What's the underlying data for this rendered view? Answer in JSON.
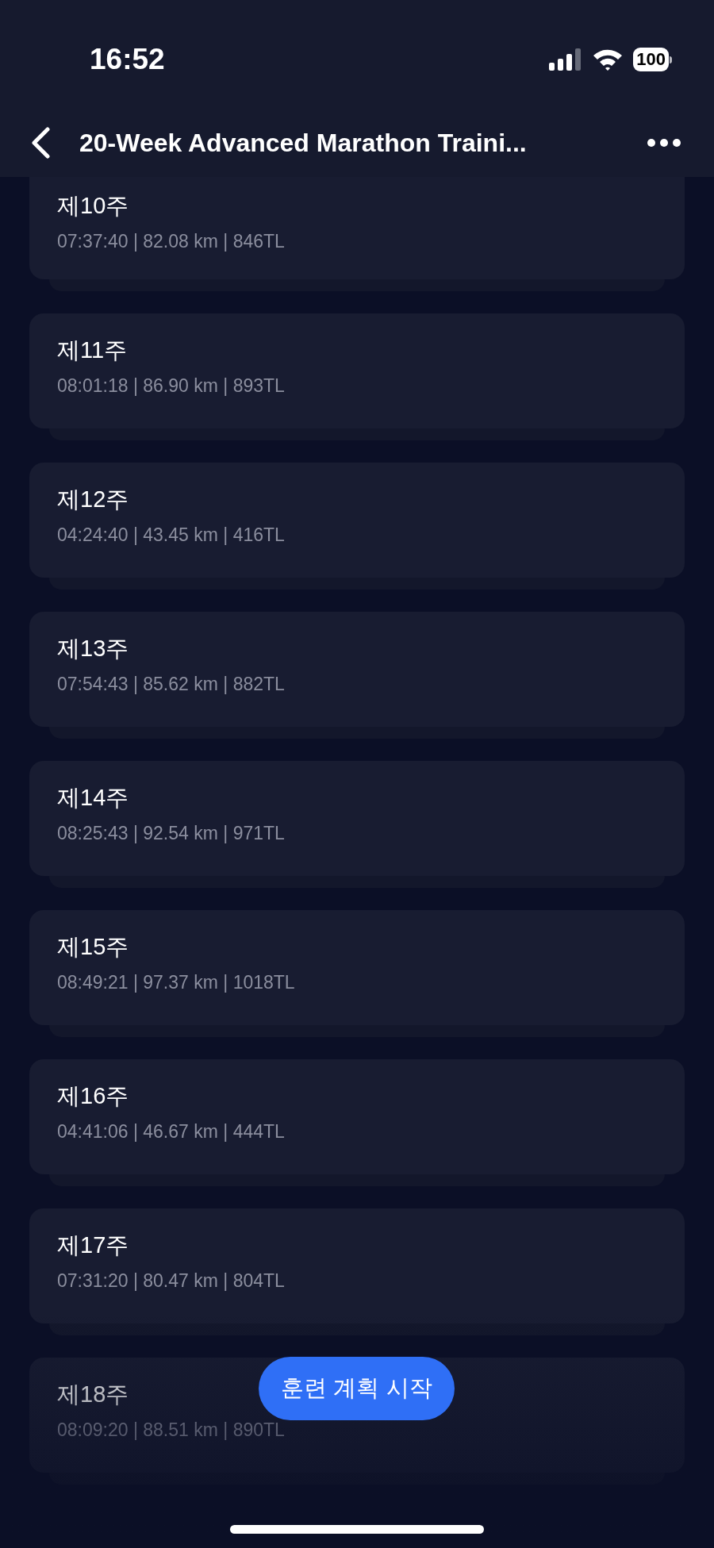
{
  "status_bar": {
    "time": "16:52",
    "battery": "100"
  },
  "nav_bar": {
    "title": "20-Week Advanced Marathon Traini..."
  },
  "weeks": [
    {
      "title": "제10주",
      "summary": "07:37:40 | 82.08 km | 846TL"
    },
    {
      "title": "제11주",
      "summary": "08:01:18 | 86.90 km | 893TL"
    },
    {
      "title": "제12주",
      "summary": "04:24:40 | 43.45 km | 416TL"
    },
    {
      "title": "제13주",
      "summary": "07:54:43 | 85.62 km | 882TL"
    },
    {
      "title": "제14주",
      "summary": "08:25:43 | 92.54 km | 971TL"
    },
    {
      "title": "제15주",
      "summary": "08:49:21 | 97.37 km | 1018TL"
    },
    {
      "title": "제16주",
      "summary": "04:41:06 | 46.67 km | 444TL"
    },
    {
      "title": "제17주",
      "summary": "07:31:20 | 80.47 km | 804TL"
    },
    {
      "title": "제18주",
      "summary": "08:09:20 | 88.51 km | 890TL"
    }
  ],
  "start_button": {
    "label": "훈련 계획 시작"
  }
}
